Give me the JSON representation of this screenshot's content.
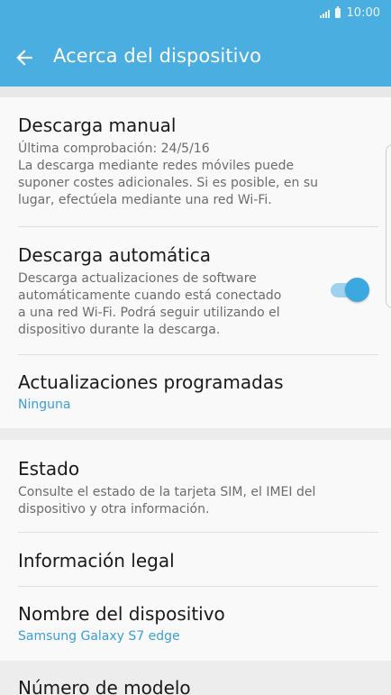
{
  "status_bar": {
    "time": "10:00",
    "icons": [
      "signal-icon",
      "battery-icon"
    ]
  },
  "app_bar": {
    "title": "Acerca del dispositivo",
    "back_icon": "arrow-left-icon",
    "color": "#4aaee0"
  },
  "settings": {
    "manual_download": {
      "title": "Descarga manual",
      "subtitle_lines": [
        "Última comprobación: 24/5/16",
        "La descarga mediante redes móviles puede",
        "suponer costes adicionales. Si es posible, en su",
        "lugar, efectúela mediante una red Wi-Fi."
      ]
    },
    "auto_download": {
      "title": "Descarga automática",
      "subtitle_lines": [
        "Descarga actualizaciones de software",
        "automáticamente cuando está conectado",
        "a una red Wi-Fi. Podrá seguir utilizando el",
        "dispositivo durante la descarga."
      ],
      "toggle_on": true
    },
    "scheduled_updates": {
      "title": "Actualizaciones programadas",
      "value": "Ninguna"
    },
    "status": {
      "title": "Estado",
      "subtitle_lines": [
        "Consulte el estado de la tarjeta SIM, el IMEI del",
        "dispositivo y otra información."
      ]
    },
    "legal_info": {
      "title": "Información legal"
    },
    "device_name": {
      "title": "Nombre del dispositivo",
      "value": "Samsung Galaxy S7 edge"
    },
    "model_number": {
      "title": "Número de modelo"
    }
  },
  "colors": {
    "accent": "#3a9fd6",
    "toggle_track": "#9fd2ee",
    "toggle_knob": "#3da7e0"
  }
}
